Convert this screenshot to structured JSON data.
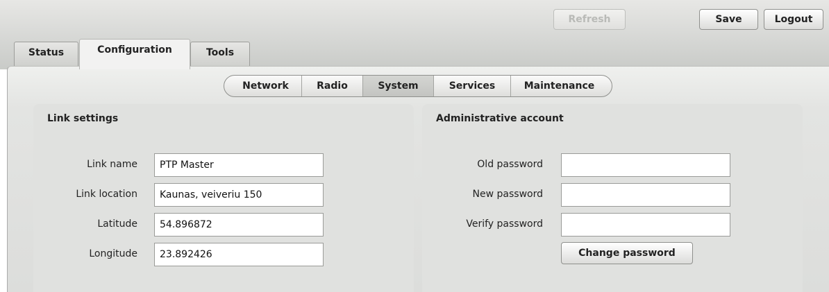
{
  "header": {
    "refresh_label": "Refresh",
    "save_label": "Save",
    "logout_label": "Logout"
  },
  "tabs": [
    {
      "label": "Status",
      "active": false
    },
    {
      "label": "Configuration",
      "active": true
    },
    {
      "label": "Tools",
      "active": false
    }
  ],
  "subnav": [
    {
      "label": "Network",
      "active": false
    },
    {
      "label": "Radio",
      "active": false
    },
    {
      "label": "System",
      "active": true
    },
    {
      "label": "Services",
      "active": false
    },
    {
      "label": "Maintenance",
      "active": false
    }
  ],
  "link_settings": {
    "title": "Link settings",
    "fields": [
      {
        "label": "Link name",
        "value": "PTP Master"
      },
      {
        "label": "Link location",
        "value": "Kaunas, veiveriu 150"
      },
      {
        "label": "Latitude",
        "value": "54.896872"
      },
      {
        "label": "Longitude",
        "value": "23.892426"
      }
    ]
  },
  "admin_account": {
    "title": "Administrative account",
    "fields": [
      {
        "label": "Old password",
        "value": ""
      },
      {
        "label": "New password",
        "value": ""
      },
      {
        "label": "Verify password",
        "value": ""
      }
    ],
    "change_password_label": "Change password"
  }
}
